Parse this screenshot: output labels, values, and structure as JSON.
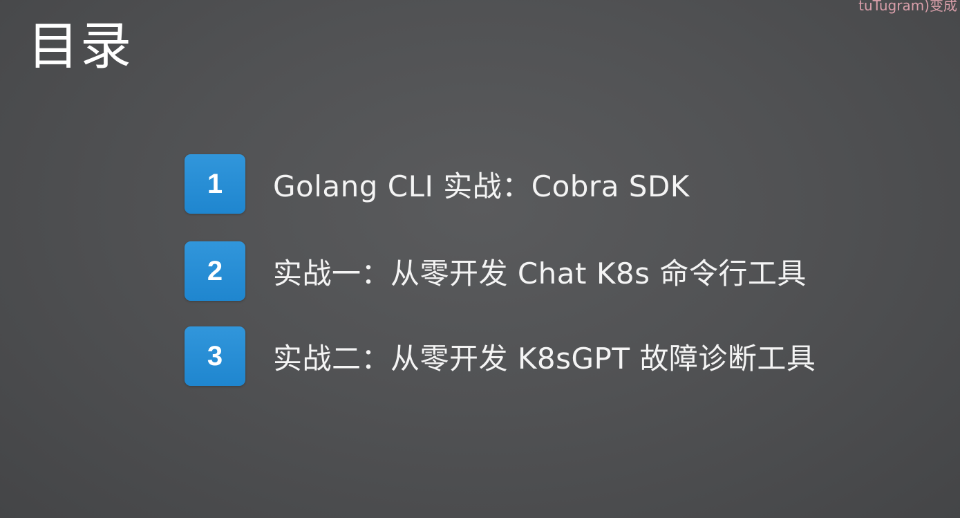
{
  "slide": {
    "title": "目录",
    "watermark": "tuTugram)变成"
  },
  "agenda": {
    "items": [
      {
        "number": "1",
        "text": "Golang CLI 实战：Cobra SDK"
      },
      {
        "number": "2",
        "text": "实战一：从零开发 Chat K8s 命令行工具"
      },
      {
        "number": "3",
        "text": "实战二：从零开发 K8sGPT 故障诊断工具"
      }
    ]
  },
  "colors": {
    "background": "#515254",
    "badge": "#2b8fd6",
    "text": "#ffffff"
  }
}
